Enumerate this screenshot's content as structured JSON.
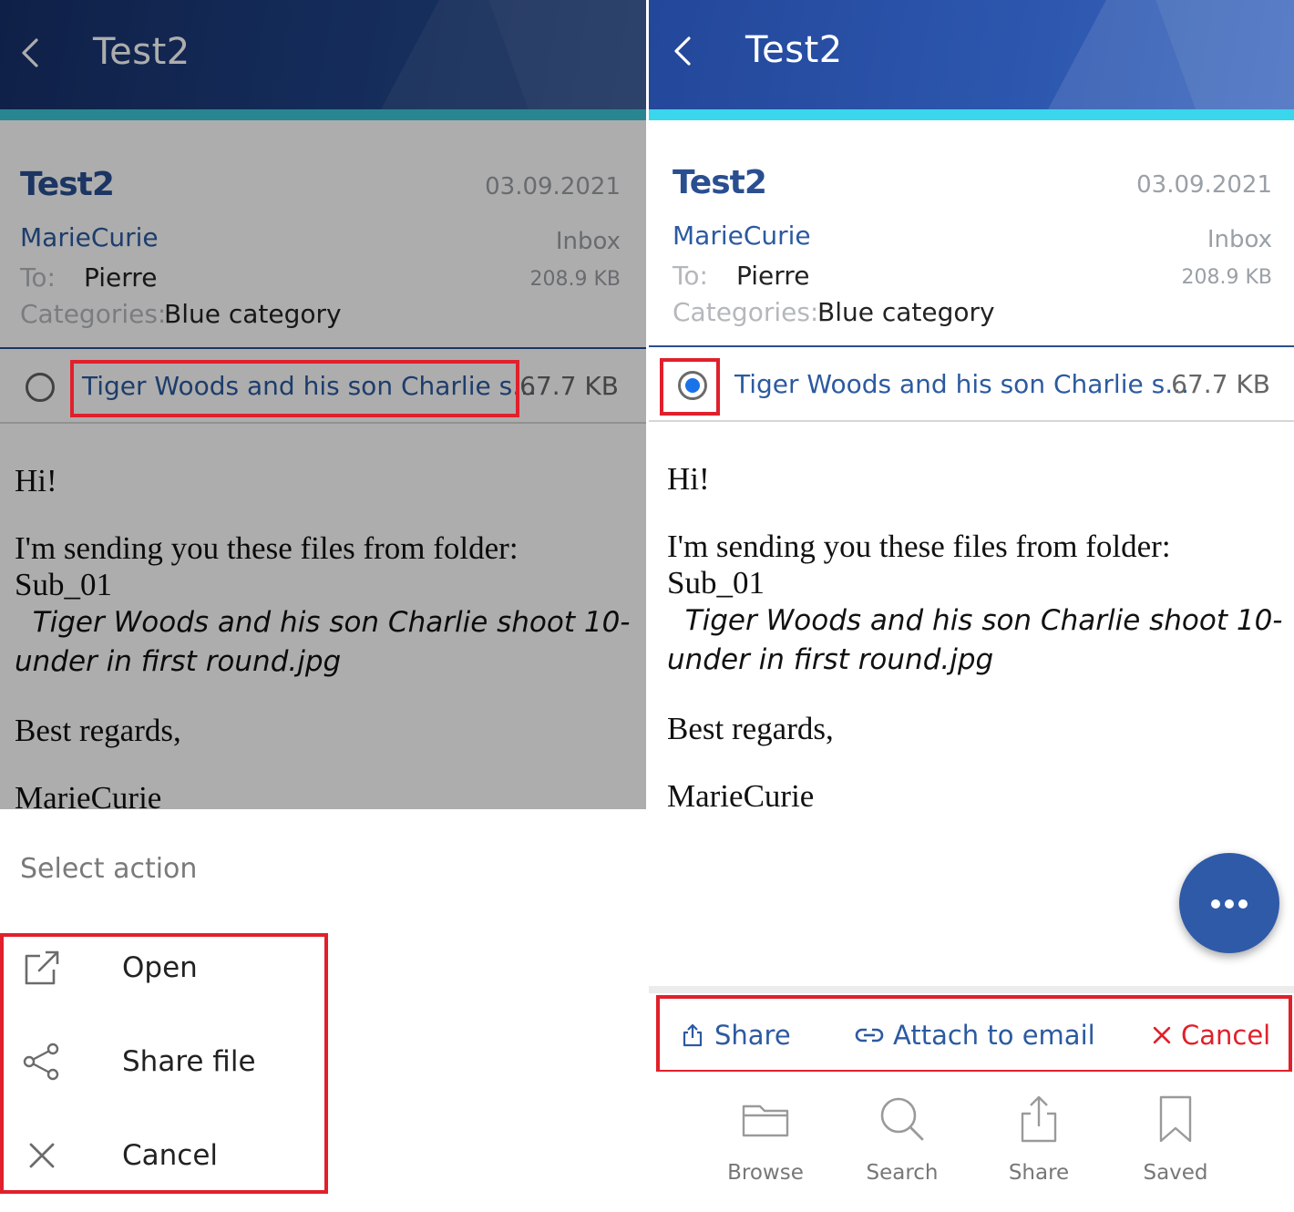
{
  "colors": {
    "header_dark": "#1b3b7a",
    "header_light": "#2f5aa8",
    "header_accent": "#3bc6d6",
    "link_blue": "#2c5aa0",
    "radio_selected": "#1a73e8",
    "highlight_red": "#e0202b",
    "cancel_red": "#e0202b"
  },
  "left": {
    "appbar": {
      "title": "Test2"
    },
    "email": {
      "subject": "Test2",
      "date": "03.09.2021",
      "sender": "MarieCurie",
      "folder": "Inbox",
      "to_label": "To:",
      "to_value": "Pierre",
      "size": "208.9 KB",
      "categories_label": "Categories:",
      "categories_value": "Blue category"
    },
    "attachment": {
      "name": "Tiger Woods and his son Charlie s...",
      "size": "67.7 KB",
      "selected": false
    },
    "body": {
      "greeting": "Hi!",
      "line1": "I'm sending you these files from folder:",
      "line2": "Sub_01",
      "file_line1": "  Tiger Woods and his son Charlie shoot 10-",
      "file_line2": "under in first round.jpg",
      "closing": "Best regards,",
      "signature": "MarieCurie"
    },
    "sheet": {
      "title": "Select action",
      "items": [
        {
          "label": "Open",
          "icon": "open-external-icon"
        },
        {
          "label": "Share file",
          "icon": "share-nodes-icon"
        },
        {
          "label": "Cancel",
          "icon": "close-icon"
        }
      ]
    }
  },
  "right": {
    "appbar": {
      "title": "Test2"
    },
    "email": {
      "subject": "Test2",
      "date": "03.09.2021",
      "sender": "MarieCurie",
      "folder": "Inbox",
      "to_label": "To:",
      "to_value": "Pierre",
      "size": "208.9 KB",
      "categories_label": "Categories:",
      "categories_value": "Blue category"
    },
    "attachment": {
      "name": "Tiger Woods and his son Charlie s...",
      "size": "67.7 KB",
      "selected": true
    },
    "body": {
      "greeting": "Hi!",
      "line1": "I'm sending you these files from folder:",
      "line2": "Sub_01",
      "file_line1": "  Tiger Woods and his son Charlie shoot 10-",
      "file_line2": "under in first round.jpg",
      "closing": "Best regards,",
      "signature": "MarieCurie"
    },
    "fab": {
      "icon": "more-dots-icon"
    },
    "actions": [
      {
        "label": "Share",
        "icon": "share-upload-icon"
      },
      {
        "label": "Attach to email",
        "icon": "link-icon"
      },
      {
        "label": "Cancel",
        "icon": "close-icon"
      }
    ],
    "tabs": [
      {
        "label": "Browse",
        "icon": "folder-icon"
      },
      {
        "label": "Search",
        "icon": "search-icon"
      },
      {
        "label": "Share",
        "icon": "share-upload-icon"
      },
      {
        "label": "Saved",
        "icon": "bookmark-icon"
      }
    ]
  }
}
